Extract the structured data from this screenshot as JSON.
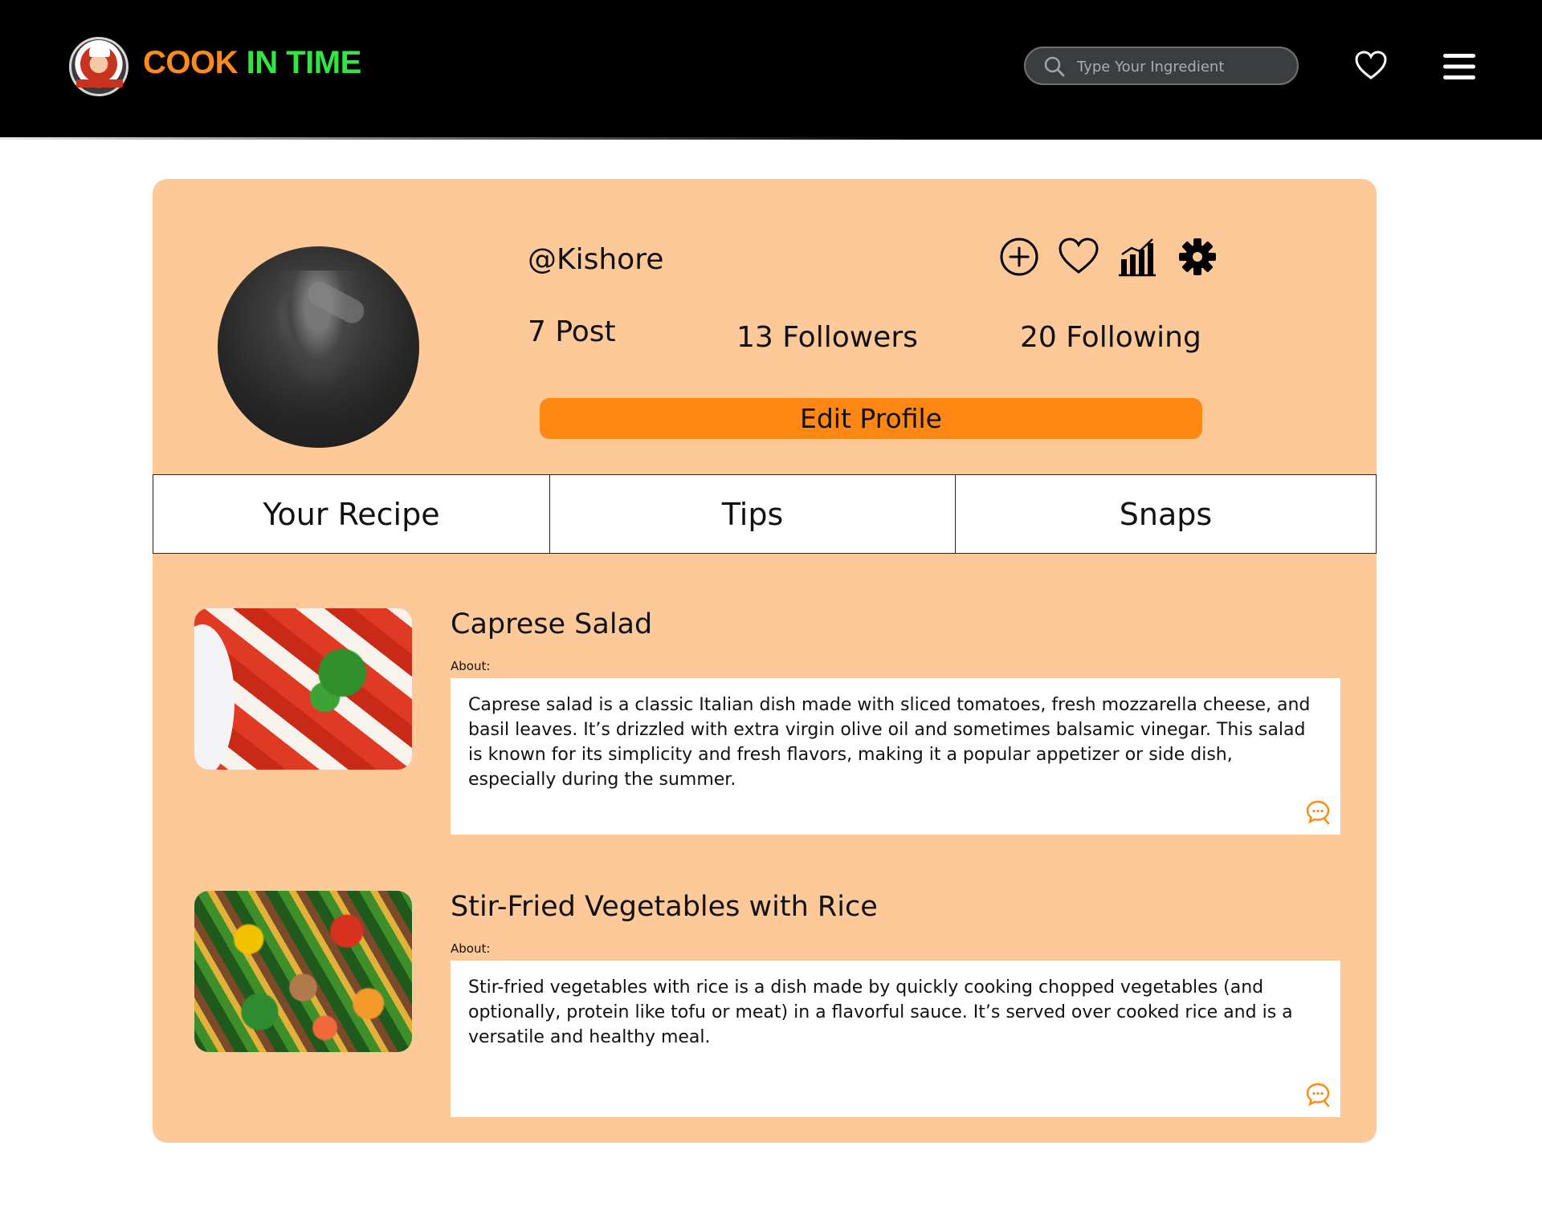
{
  "header": {
    "brand_part1": "COOK ",
    "brand_part2": "IN TIME",
    "search_placeholder": "Type Your Ingredient",
    "brand_colors": {
      "orange": "#ff8a1e",
      "green": "#33e544"
    }
  },
  "profile": {
    "username": "@Kishore",
    "posts": "7 Post",
    "followers": "13 Followers",
    "following": "20 Following",
    "edit_label": "Edit Profile",
    "actions": [
      "add-icon",
      "heart-icon",
      "stats-icon",
      "settings-icon"
    ]
  },
  "tabs": [
    {
      "label": "Your Recipe"
    },
    {
      "label": "Tips"
    },
    {
      "label": "Snaps"
    }
  ],
  "recipes": [
    {
      "title": "Caprese Salad",
      "about_label": "About:",
      "description": "Caprese salad is a classic Italian dish made with sliced tomatoes, fresh mozzarella cheese, and basil leaves. It’s drizzled with extra virgin olive oil and sometimes balsamic vinegar. This salad is known for its simplicity and fresh flavors, making it a popular appetizer or side dish, especially during the summer."
    },
    {
      "title": "Stir-Fried Vegetables with Rice",
      "about_label": "About:",
      "description": "Stir-fried vegetables with rice is a dish made by quickly cooking chopped vegetables (and optionally, protein like tofu or meat) in a flavorful sauce. It’s served over cooked rice and is a versatile and healthy meal."
    }
  ],
  "colors": {
    "card_bg": "#fec999",
    "accent": "#ff8713",
    "header_bg": "#000000"
  }
}
